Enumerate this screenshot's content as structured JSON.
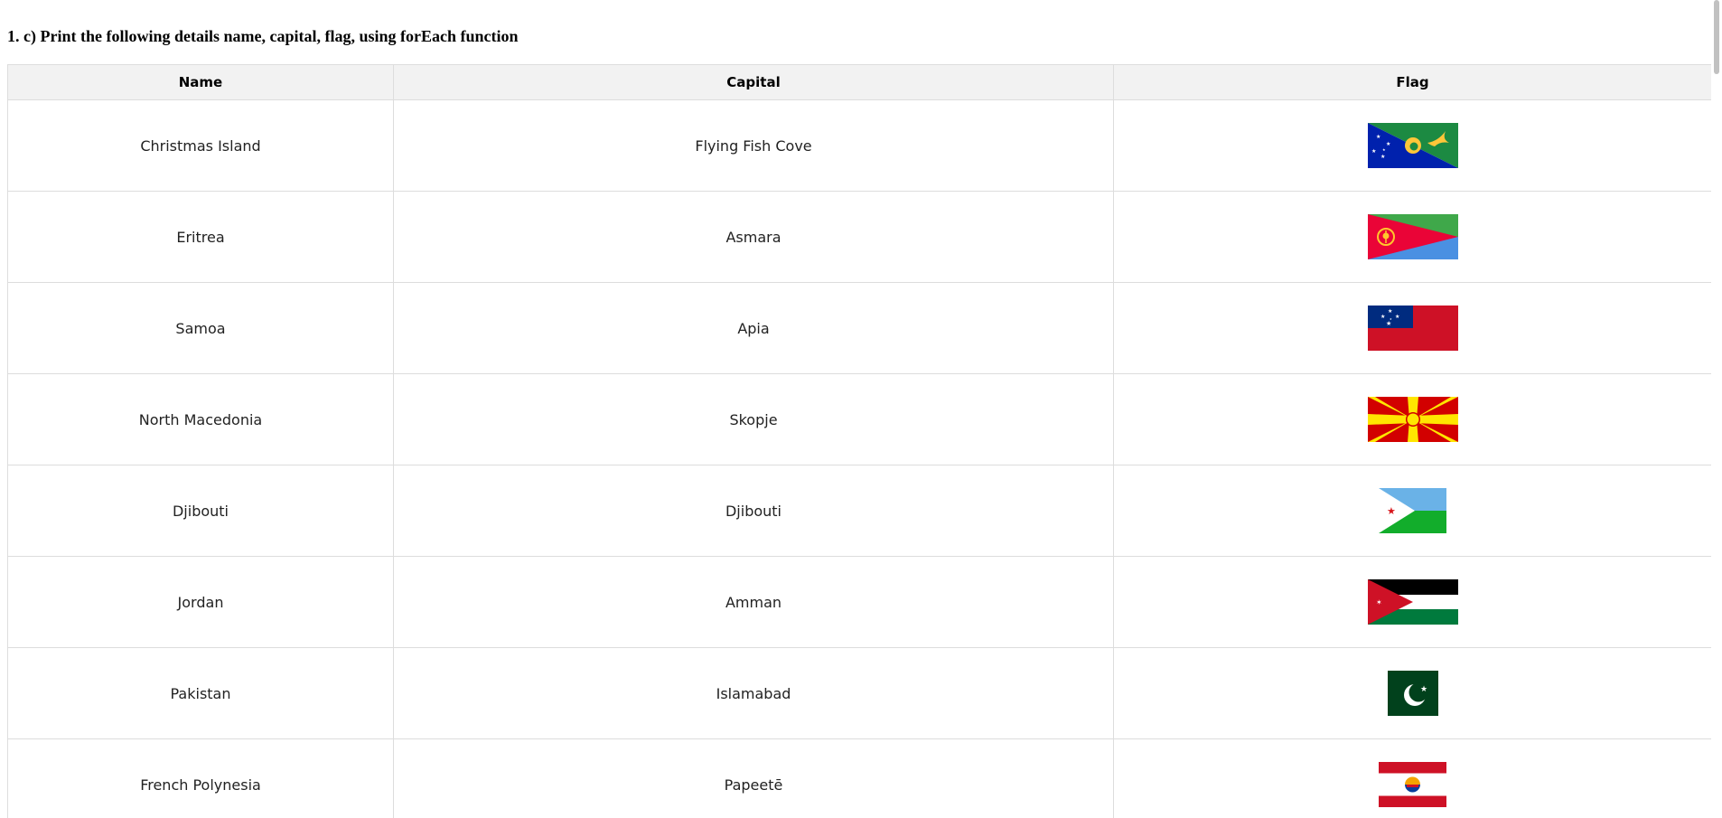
{
  "heading": "1. c) Print the following details name, capital, flag, using forEach function",
  "table": {
    "headers": {
      "name": "Name",
      "capital": "Capital",
      "flag": "Flag"
    },
    "rows": [
      {
        "name": "Christmas Island",
        "capital": "Flying Fish Cove",
        "flag_icon": "christmas-island-flag"
      },
      {
        "name": "Eritrea",
        "capital": "Asmara",
        "flag_icon": "eritrea-flag"
      },
      {
        "name": "Samoa",
        "capital": "Apia",
        "flag_icon": "samoa-flag"
      },
      {
        "name": "North Macedonia",
        "capital": "Skopje",
        "flag_icon": "north-macedonia-flag"
      },
      {
        "name": "Djibouti",
        "capital": "Djibouti",
        "flag_icon": "djibouti-flag"
      },
      {
        "name": "Jordan",
        "capital": "Amman",
        "flag_icon": "jordan-flag"
      },
      {
        "name": "Pakistan",
        "capital": "Islamabad",
        "flag_icon": "pakistan-flag"
      },
      {
        "name": "French Polynesia",
        "capital": "Papeetē",
        "flag_icon": "french-polynesia-flag"
      }
    ]
  },
  "colors": {
    "header_background": "#f2f2f2",
    "border": "#dddddd",
    "text": "#222222"
  }
}
